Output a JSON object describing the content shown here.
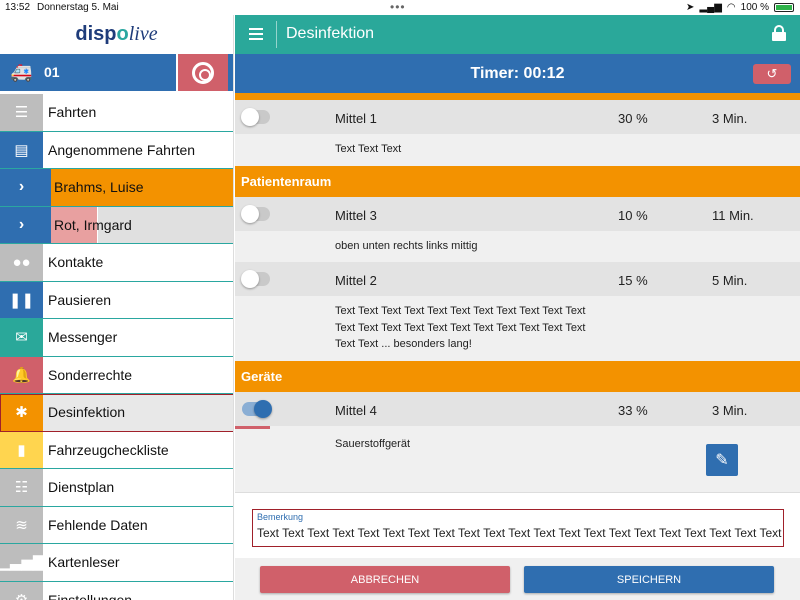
{
  "statusbar": {
    "time": "13:52",
    "date": "Donnerstag 5. Mai",
    "battery": "100 %"
  },
  "sidebar": {
    "logo_a": "disp",
    "logo_b": "o",
    "logo_c": "live",
    "vehicle_number": "01",
    "items": [
      {
        "label": "Fahrten",
        "icon": "list-icon",
        "color": "#bdbdbd"
      },
      {
        "label": "Angenommene Fahrten",
        "icon": "id-card-icon",
        "color": "#2f6eb0"
      },
      {
        "label": "Brahms, Luise",
        "icon": "chevron-right-icon",
        "color": "#f39200"
      },
      {
        "label": "Rot, Irmgard",
        "icon": "chevron-right-icon",
        "color": "#e8a0a0"
      },
      {
        "label": "Kontakte",
        "icon": "users-icon",
        "color": "#bdbdbd"
      },
      {
        "label": "Pausieren",
        "icon": "pause-icon",
        "color": "#2f6eb0"
      },
      {
        "label": "Messenger",
        "icon": "envelope-icon",
        "color": "#2aa89a"
      },
      {
        "label": "Sonderrechte",
        "icon": "bell-icon",
        "color": "#d0606a"
      },
      {
        "label": "Desinfektion",
        "icon": "bug-icon",
        "color": "#f39200"
      },
      {
        "label": "Fahrzeugcheckliste",
        "icon": "book-icon",
        "color": "#ffd54f"
      },
      {
        "label": "Dienstplan",
        "icon": "list-alt-icon",
        "color": "#bdbdbd"
      },
      {
        "label": "Fehlende Daten",
        "icon": "database-icon",
        "color": "#bdbdbd"
      },
      {
        "label": "Kartenleser",
        "icon": "signal-bars-icon",
        "color": "#bdbdbd"
      },
      {
        "label": "Einstellungen",
        "icon": "wrench-icon",
        "color": "#bdbdbd"
      }
    ]
  },
  "header": {
    "title": "Desinfektion",
    "timer": "Timer: 00:12"
  },
  "disinfection": {
    "row1": {
      "name": "Mittel 1",
      "percent": "30 %",
      "duration": "3 Min.",
      "on": false,
      "desc": "Text Text Text"
    },
    "section1": "Patientenraum",
    "row2": {
      "name": "Mittel 3",
      "percent": "10 %",
      "duration": "11 Min.",
      "on": false,
      "desc": "oben unten rechts links mittig"
    },
    "row3": {
      "name": "Mittel 2",
      "percent": "15 %",
      "duration": "5 Min.",
      "on": false,
      "desc_line1": "Text Text Text Text Text Text Text Text Text Text Text",
      "desc_line2": "Text Text Text Text Text Text Text Text Text Text Text",
      "desc_line3": "Text Text ... besonders lang!"
    },
    "section2": "Geräte",
    "row4": {
      "name": "Mittel 4",
      "percent": "33 %",
      "duration": "3 Min.",
      "on": true,
      "desc": "Sauerstoffgerät"
    }
  },
  "remarks": {
    "label": "Bemerkung",
    "value": "Text Text Text Text Text Text Text Text Text Text Text Text Text Text Text Text Text Text Text Text Text Text T"
  },
  "buttons": {
    "cancel": "ABBRECHEN",
    "save": "SPEICHERN"
  },
  "colors": {
    "teal": "#2aa89a",
    "blue": "#2f6eb0",
    "orange": "#f39200",
    "red": "#d0606a"
  }
}
